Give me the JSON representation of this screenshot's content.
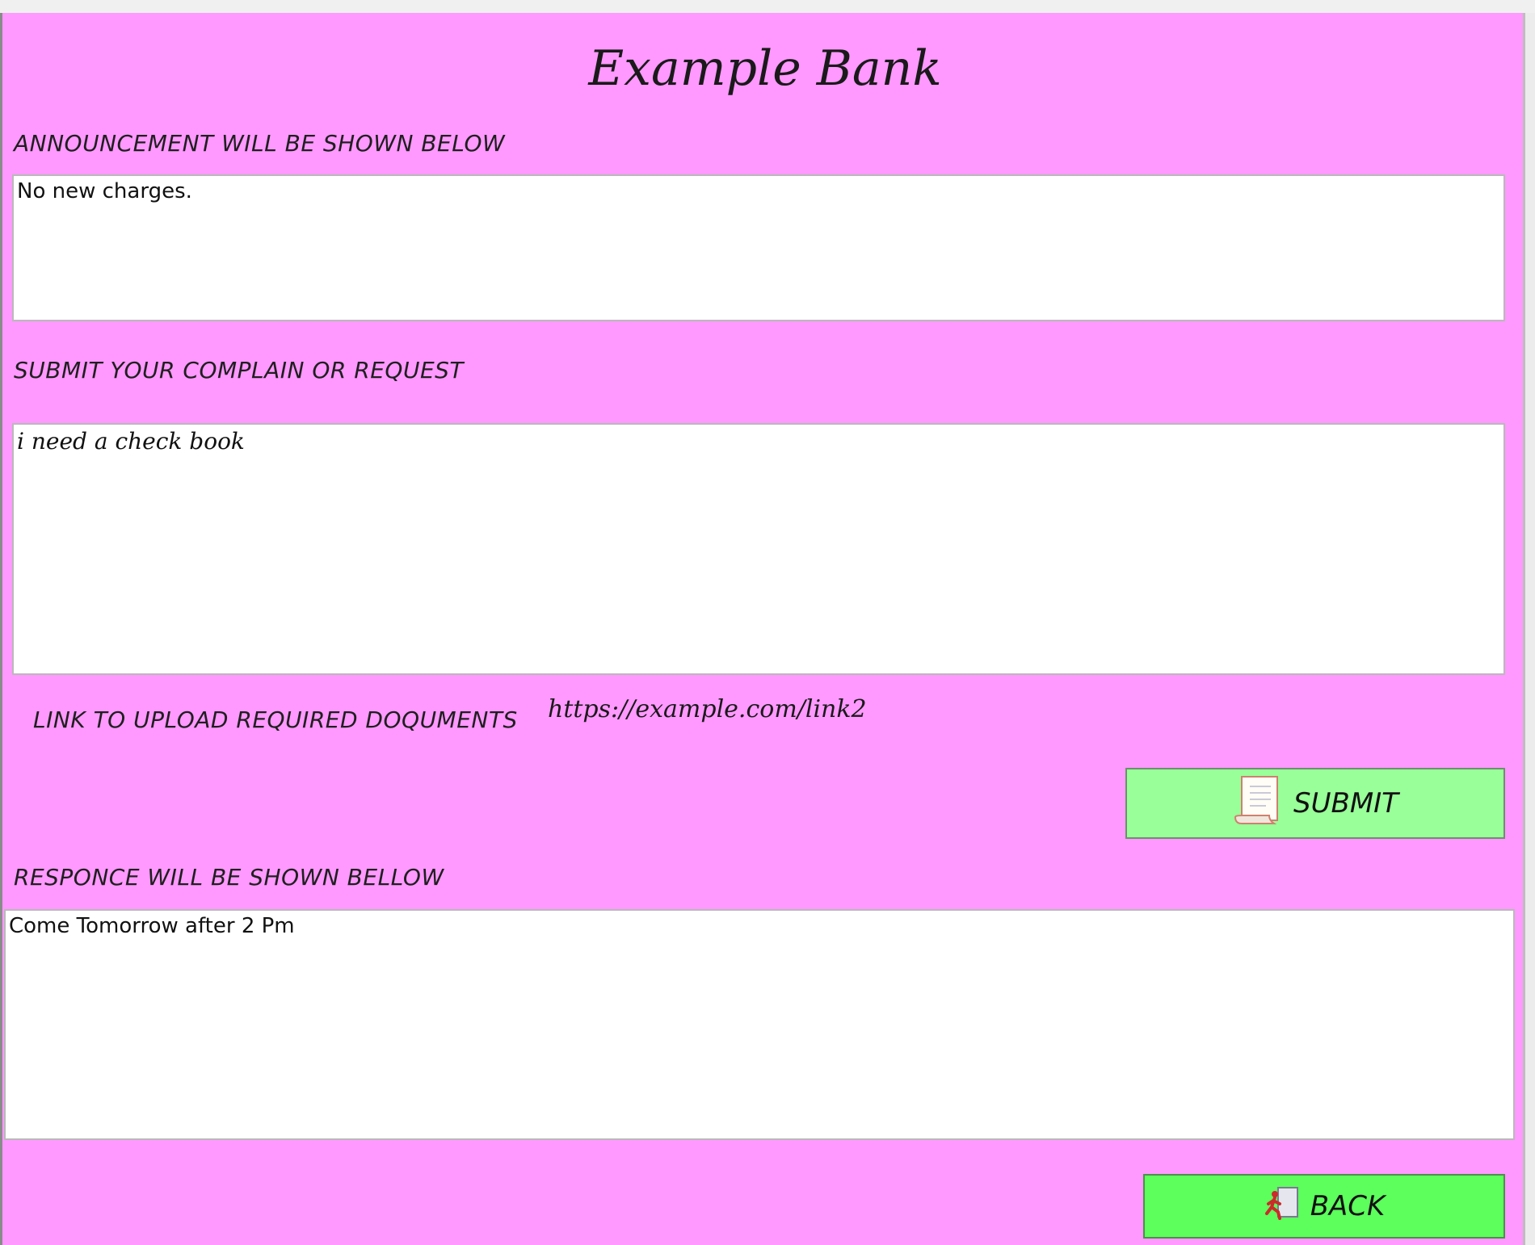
{
  "app": {
    "title": "Example Bank"
  },
  "announcement": {
    "label": "ANNOUNCEMENT WILL BE SHOWN BELOW",
    "text": "No new charges."
  },
  "complaint": {
    "label": "SUBMIT YOUR COMPLAIN OR REQUEST",
    "text": "i need a check book"
  },
  "upload": {
    "label": "LINK TO UPLOAD REQUIRED DOQUMENTS",
    "link": "https://example.com/link2"
  },
  "submit_button": {
    "label": "SUBMIT",
    "icon": "document-scroll-icon"
  },
  "response": {
    "label": "RESPONCE WILL BE SHOWN BELLOW",
    "text": "Come Tomorrow after 2 Pm"
  },
  "back_button": {
    "label": "BACK",
    "icon": "exit-runner-icon"
  },
  "colors": {
    "background": "#ff99ff",
    "submit_bg": "#99ff99",
    "back_bg": "#5cff5c"
  }
}
